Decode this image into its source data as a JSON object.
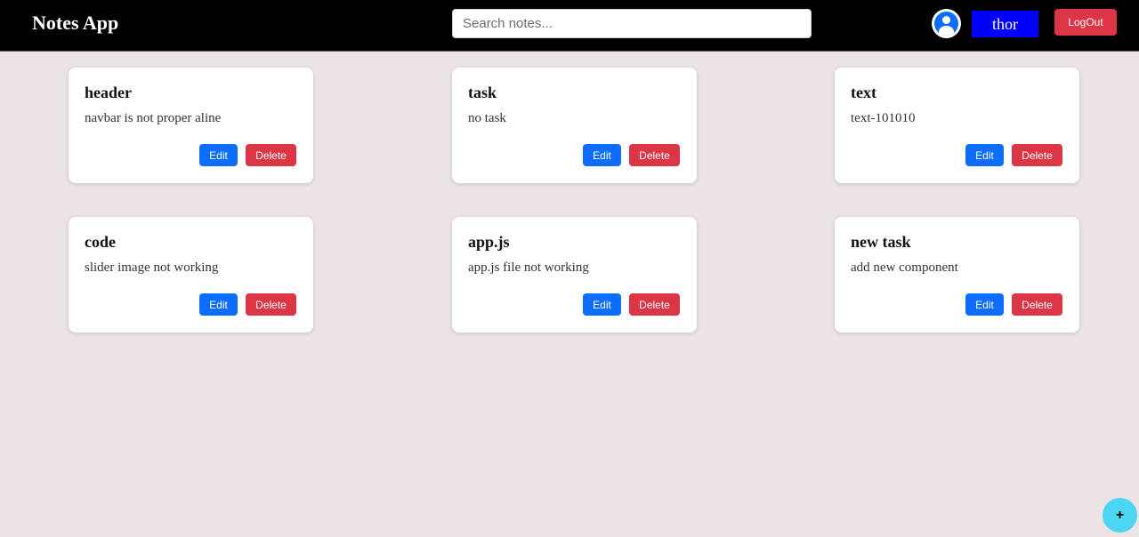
{
  "navbar": {
    "brand": "Notes App",
    "search_placeholder": "Search notes...",
    "search_value": "",
    "username": "thor",
    "logout_label": "LogOut",
    "avatar_icon": "user-circle-icon"
  },
  "notes": [
    {
      "title": "header",
      "text": "navbar is not proper aline",
      "edit_label": "Edit",
      "delete_label": "Delete"
    },
    {
      "title": "task",
      "text": "no task",
      "edit_label": "Edit",
      "delete_label": "Delete"
    },
    {
      "title": "text",
      "text": "text-101010",
      "edit_label": "Edit",
      "delete_label": "Delete"
    },
    {
      "title": "code",
      "text": "slider image not working",
      "edit_label": "Edit",
      "delete_label": "Delete"
    },
    {
      "title": "app.js",
      "text": "app.js file not working",
      "edit_label": "Edit",
      "delete_label": "Delete"
    },
    {
      "title": "new task",
      "text": "add new component",
      "edit_label": "Edit",
      "delete_label": "Delete"
    }
  ],
  "fab": {
    "label": "+"
  },
  "colors": {
    "navbar": "#000000",
    "page_background": "#ebe3e4",
    "edit": "#0d6efd",
    "delete": "#dc3545",
    "user_button": "#0000ff",
    "fab": "#4dd6f2"
  }
}
